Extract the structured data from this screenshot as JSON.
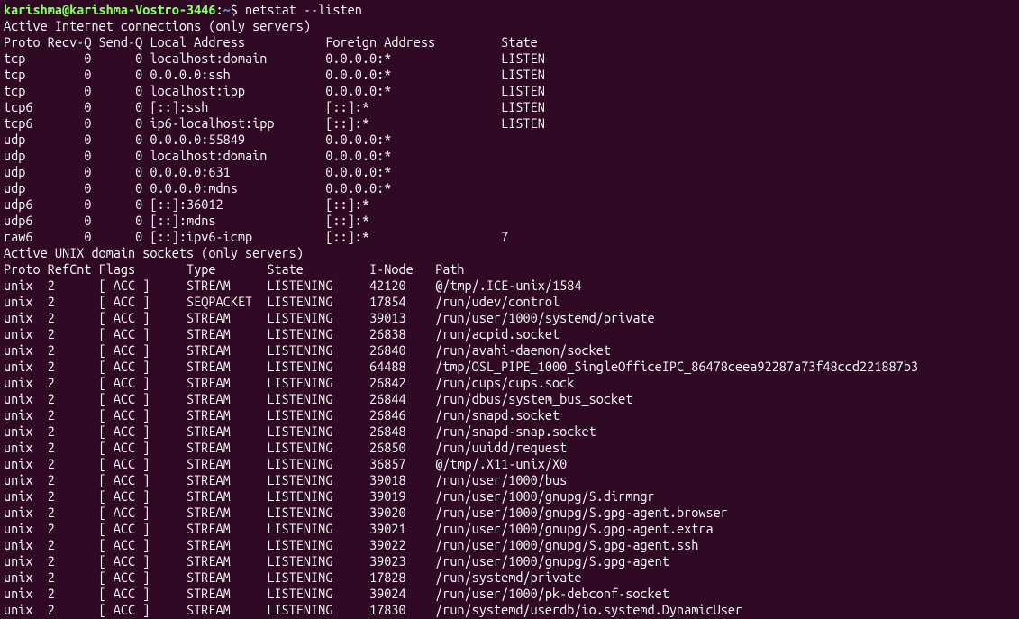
{
  "prompt": {
    "user_host": "karishma@karishma-Vostro-3446",
    "colon": ":",
    "path": "~",
    "dollar": "$ ",
    "command": "netstat --listen"
  },
  "inet_header": "Active Internet connections (only servers)",
  "inet_cols": "Proto Recv-Q Send-Q Local Address           Foreign Address         State      ",
  "inet_rows": [
    "tcp        0      0 localhost:domain        0.0.0.0:*               LISTEN     ",
    "tcp        0      0 0.0.0.0:ssh             0.0.0.0:*               LISTEN     ",
    "tcp        0      0 localhost:ipp           0.0.0.0:*               LISTEN     ",
    "tcp6       0      0 [::]:ssh                [::]:*                  LISTEN     ",
    "tcp6       0      0 ip6-localhost:ipp       [::]:*                  LISTEN     ",
    "udp        0      0 0.0.0.0:55849           0.0.0.0:*                          ",
    "udp        0      0 localhost:domain        0.0.0.0:*                          ",
    "udp        0      0 0.0.0.0:631             0.0.0.0:*                          ",
    "udp        0      0 0.0.0.0:mdns            0.0.0.0:*                          ",
    "udp6       0      0 [::]:36012              [::]:*                             ",
    "udp6       0      0 [::]:mdns               [::]:*                             ",
    "raw6       0      0 [::]:ipv6-icmp          [::]:*                  7          "
  ],
  "unix_header": "Active UNIX domain sockets (only servers)",
  "unix_cols": "Proto RefCnt Flags       Type       State         I-Node   Path",
  "unix_rows": [
    "unix  2      [ ACC ]     STREAM     LISTENING     42120    @/tmp/.ICE-unix/1584",
    "unix  2      [ ACC ]     SEQPACKET  LISTENING     17854    /run/udev/control",
    "unix  2      [ ACC ]     STREAM     LISTENING     39013    /run/user/1000/systemd/private",
    "unix  2      [ ACC ]     STREAM     LISTENING     26838    /run/acpid.socket",
    "unix  2      [ ACC ]     STREAM     LISTENING     26840    /run/avahi-daemon/socket",
    "unix  2      [ ACC ]     STREAM     LISTENING     64488    /tmp/OSL_PIPE_1000_SingleOfficeIPC_86478ceea92287a73f48ccd221887b3",
    "unix  2      [ ACC ]     STREAM     LISTENING     26842    /run/cups/cups.sock",
    "unix  2      [ ACC ]     STREAM     LISTENING     26844    /run/dbus/system_bus_socket",
    "unix  2      [ ACC ]     STREAM     LISTENING     26846    /run/snapd.socket",
    "unix  2      [ ACC ]     STREAM     LISTENING     26848    /run/snapd-snap.socket",
    "unix  2      [ ACC ]     STREAM     LISTENING     26850    /run/uuidd/request",
    "unix  2      [ ACC ]     STREAM     LISTENING     36857    @/tmp/.X11-unix/X0",
    "unix  2      [ ACC ]     STREAM     LISTENING     39018    /run/user/1000/bus",
    "unix  2      [ ACC ]     STREAM     LISTENING     39019    /run/user/1000/gnupg/S.dirmngr",
    "unix  2      [ ACC ]     STREAM     LISTENING     39020    /run/user/1000/gnupg/S.gpg-agent.browser",
    "unix  2      [ ACC ]     STREAM     LISTENING     39021    /run/user/1000/gnupg/S.gpg-agent.extra",
    "unix  2      [ ACC ]     STREAM     LISTENING     39022    /run/user/1000/gnupg/S.gpg-agent.ssh",
    "unix  2      [ ACC ]     STREAM     LISTENING     39023    /run/user/1000/gnupg/S.gpg-agent",
    "unix  2      [ ACC ]     STREAM     LISTENING     17828    /run/systemd/private",
    "unix  2      [ ACC ]     STREAM     LISTENING     39024    /run/user/1000/pk-debconf-socket",
    "unix  2      [ ACC ]     STREAM     LISTENING     17830    /run/systemd/userdb/io.systemd.DynamicUser"
  ]
}
